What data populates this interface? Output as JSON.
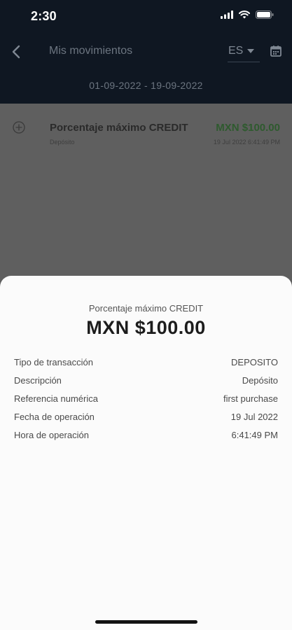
{
  "status_bar": {
    "time": "2:30"
  },
  "header": {
    "title": "Mis movimientos",
    "language": "ES",
    "date_range": "01-09-2022 - 19-09-2022"
  },
  "transactions": [
    {
      "title": "Porcentaje máximo CREDIT",
      "subtitle": "Depósito",
      "amount": "MXN $100.00",
      "date": "19 Jul 2022 6:41:49 PM"
    }
  ],
  "detail_sheet": {
    "title": "Porcentaje máximo CREDIT",
    "amount": "MXN $100.00",
    "rows": [
      {
        "label": "Tipo de transacción",
        "value": "DEPOSITO"
      },
      {
        "label": "Descripción",
        "value": "Depósito"
      },
      {
        "label": "Referencia numérica",
        "value": "first purchase"
      },
      {
        "label": "Fecha de operación",
        "value": "19 Jul 2022"
      },
      {
        "label": "Hora de operación",
        "value": "6:41:49 PM"
      }
    ]
  },
  "colors": {
    "header_bg": "#0f1722",
    "overlay_bg": "#5f5f5f",
    "amount_green": "#2e5a2e",
    "sheet_bg": "#fbfbfb"
  },
  "icons": {
    "back": "chevron-left-icon",
    "language_dropdown": "caret-down-icon",
    "calendar": "calendar-icon",
    "transaction": "plus-circle-icon",
    "signal": "signal-icon",
    "wifi": "wifi-icon",
    "battery": "battery-icon"
  }
}
